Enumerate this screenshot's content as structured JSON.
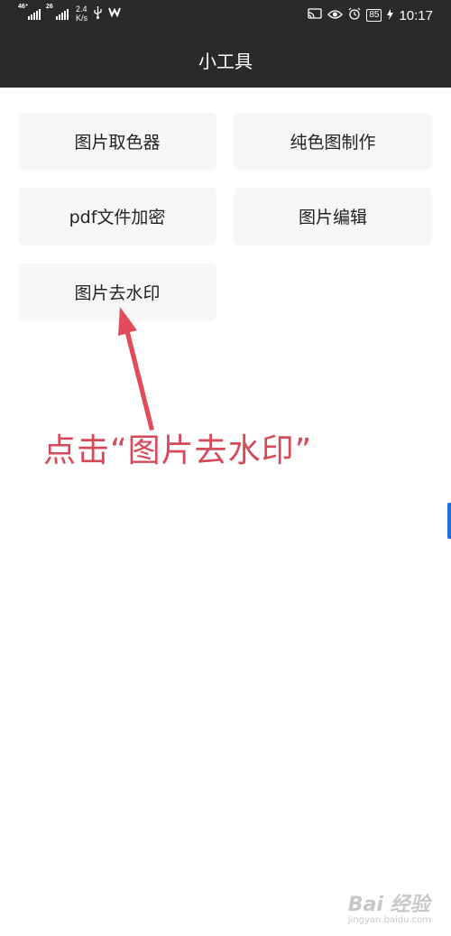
{
  "status_bar": {
    "sim1_label": "46⁺",
    "sim2_label": "26",
    "net_speed_value": "2.4",
    "net_speed_unit": "K/s",
    "battery": "85",
    "time": "10:17"
  },
  "header": {
    "title": "小工具"
  },
  "tools": [
    {
      "label": "图片取色器"
    },
    {
      "label": "纯色图制作"
    },
    {
      "label": "pdf文件加密"
    },
    {
      "label": "图片编辑"
    },
    {
      "label": "图片去水印"
    }
  ],
  "annotation": {
    "text": "点击“图片去水印”",
    "color": "#d44a58"
  },
  "watermark": {
    "brand": "Bai 经验",
    "url": "jingyan.baidu.com"
  },
  "colors": {
    "bar_background": "#2a2a2a",
    "button_background": "#f6f6f6",
    "accent_edge": "#1e6fd9"
  }
}
